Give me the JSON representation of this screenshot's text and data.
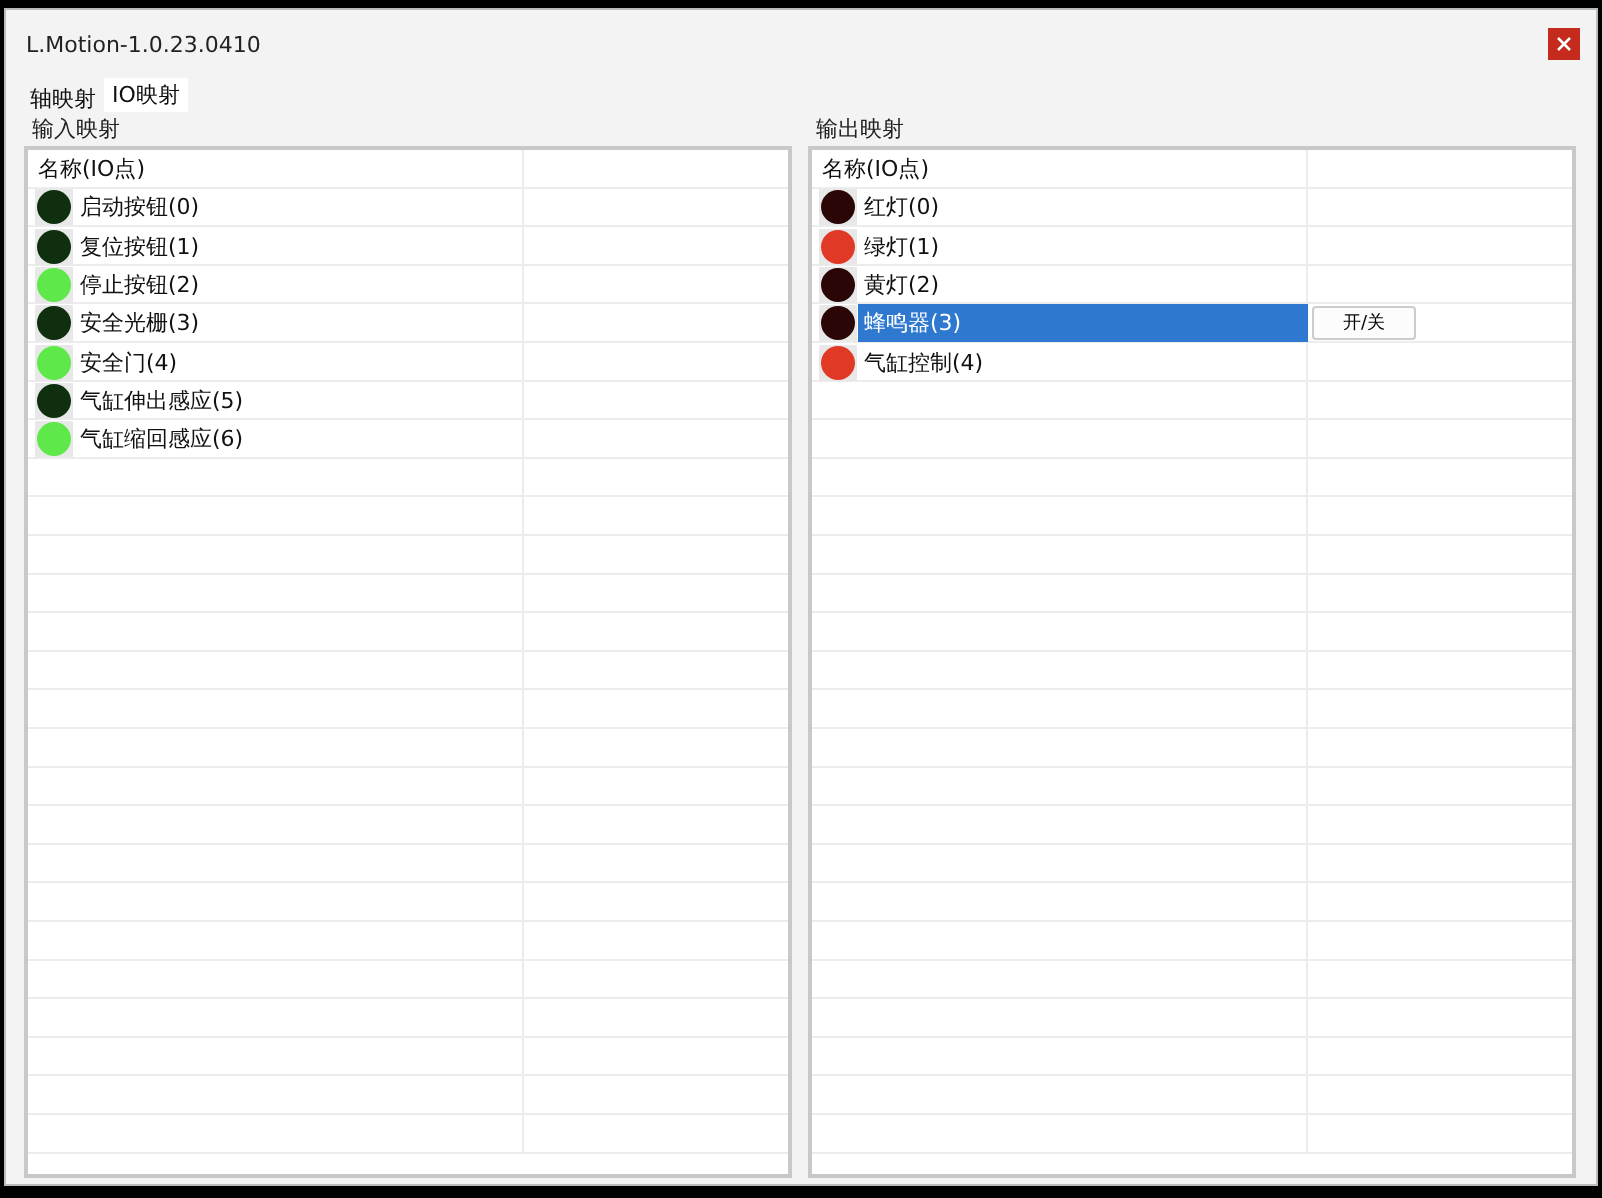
{
  "window": {
    "title": "L.Motion-1.0.23.0410"
  },
  "tabs": [
    {
      "label": "轴映射",
      "selected": false
    },
    {
      "label": "IO映射",
      "selected": true
    }
  ],
  "panels": [
    {
      "kind": "input",
      "title": "输入映射",
      "header": "名称(IO点)",
      "rows": [
        {
          "name": "启动按钮(0)",
          "on": false,
          "selected": false
        },
        {
          "name": "复位按钮(1)",
          "on": false,
          "selected": false
        },
        {
          "name": "停止按钮(2)",
          "on": true,
          "selected": false
        },
        {
          "name": "安全光栅(3)",
          "on": false,
          "selected": false
        },
        {
          "name": "安全门(4)",
          "on": true,
          "selected": false
        },
        {
          "name": "气缸伸出感应(5)",
          "on": false,
          "selected": false
        },
        {
          "name": "气缸缩回感应(6)",
          "on": true,
          "selected": false
        }
      ]
    },
    {
      "kind": "output",
      "title": "输出映射",
      "header": "名称(IO点)",
      "rows": [
        {
          "name": "红灯(0)",
          "on": false,
          "selected": false
        },
        {
          "name": "绿灯(1)",
          "on": true,
          "selected": false
        },
        {
          "name": "黄灯(2)",
          "on": false,
          "selected": false
        },
        {
          "name": "蜂鸣器(3)",
          "on": false,
          "selected": true,
          "action": "开/关"
        },
        {
          "name": "气缸控制(4)",
          "on": true,
          "selected": false
        }
      ]
    }
  ]
}
